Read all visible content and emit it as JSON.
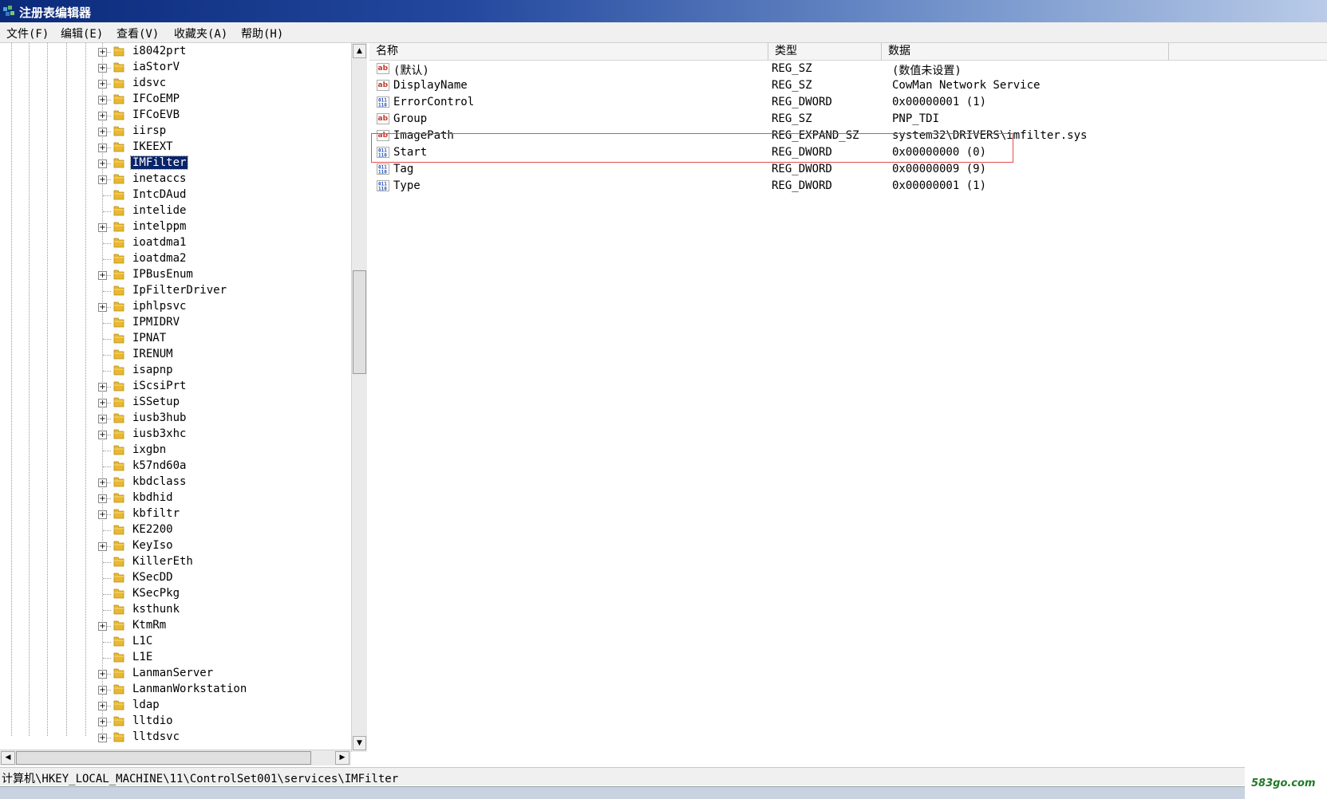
{
  "window": {
    "title": "注册表编辑器"
  },
  "menu": [
    "文件(F)",
    "编辑(E)",
    "查看(V)",
    "收藏夹(A)",
    "帮助(H)"
  ],
  "tree": {
    "selected": "IMFilter",
    "items": [
      {
        "label": "i8042prt",
        "expandable": true
      },
      {
        "label": "iaStorV",
        "expandable": true
      },
      {
        "label": "idsvc",
        "expandable": true
      },
      {
        "label": "IFCoEMP",
        "expandable": true
      },
      {
        "label": "IFCoEVB",
        "expandable": true
      },
      {
        "label": "iirsp",
        "expandable": true
      },
      {
        "label": "IKEEXT",
        "expandable": true
      },
      {
        "label": "IMFilter",
        "expandable": true
      },
      {
        "label": "inetaccs",
        "expandable": true
      },
      {
        "label": "IntcDAud",
        "expandable": false
      },
      {
        "label": "intelide",
        "expandable": false
      },
      {
        "label": "intelppm",
        "expandable": true
      },
      {
        "label": "ioatdma1",
        "expandable": false
      },
      {
        "label": "ioatdma2",
        "expandable": false
      },
      {
        "label": "IPBusEnum",
        "expandable": true
      },
      {
        "label": "IpFilterDriver",
        "expandable": false
      },
      {
        "label": "iphlpsvc",
        "expandable": true
      },
      {
        "label": "IPMIDRV",
        "expandable": false
      },
      {
        "label": "IPNAT",
        "expandable": false
      },
      {
        "label": "IRENUM",
        "expandable": false
      },
      {
        "label": "isapnp",
        "expandable": false
      },
      {
        "label": "iScsiPrt",
        "expandable": true
      },
      {
        "label": "iSSetup",
        "expandable": true
      },
      {
        "label": "iusb3hub",
        "expandable": true
      },
      {
        "label": "iusb3xhc",
        "expandable": true
      },
      {
        "label": "ixgbn",
        "expandable": false
      },
      {
        "label": "k57nd60a",
        "expandable": false
      },
      {
        "label": "kbdclass",
        "expandable": true
      },
      {
        "label": "kbdhid",
        "expandable": true
      },
      {
        "label": "kbfiltr",
        "expandable": true
      },
      {
        "label": "KE2200",
        "expandable": false
      },
      {
        "label": "KeyIso",
        "expandable": true
      },
      {
        "label": "KillerEth",
        "expandable": false
      },
      {
        "label": "KSecDD",
        "expandable": false
      },
      {
        "label": "KSecPkg",
        "expandable": false
      },
      {
        "label": "ksthunk",
        "expandable": false
      },
      {
        "label": "KtmRm",
        "expandable": true
      },
      {
        "label": "L1C",
        "expandable": false
      },
      {
        "label": "L1E",
        "expandable": false
      },
      {
        "label": "LanmanServer",
        "expandable": true
      },
      {
        "label": "LanmanWorkstation",
        "expandable": true
      },
      {
        "label": "ldap",
        "expandable": true
      },
      {
        "label": "lltdio",
        "expandable": true
      },
      {
        "label": "lltdsvc",
        "expandable": true
      }
    ]
  },
  "list": {
    "columns": [
      "名称",
      "类型",
      "数据"
    ],
    "rows": [
      {
        "icon": "string-value-icon",
        "name": "(默认)",
        "type": "REG_SZ",
        "data": "(数值未设置)"
      },
      {
        "icon": "string-value-icon",
        "name": "DisplayName",
        "type": "REG_SZ",
        "data": "CowMan Network Service"
      },
      {
        "icon": "binary-value-icon",
        "name": "ErrorControl",
        "type": "REG_DWORD",
        "data": "0x00000001 (1)"
      },
      {
        "icon": "string-value-icon",
        "name": "Group",
        "type": "REG_SZ",
        "data": "PNP_TDI"
      },
      {
        "icon": "string-value-icon",
        "name": "ImagePath",
        "type": "REG_EXPAND_SZ",
        "data": "system32\\DRIVERS\\imfilter.sys"
      },
      {
        "icon": "binary-value-icon",
        "name": "Start",
        "type": "REG_DWORD",
        "data": "0x00000000 (0)"
      },
      {
        "icon": "binary-value-icon",
        "name": "Tag",
        "type": "REG_DWORD",
        "data": "0x00000009 (9)"
      },
      {
        "icon": "binary-value-icon",
        "name": "Type",
        "type": "REG_DWORD",
        "data": "0x00000001 (1)"
      }
    ]
  },
  "status": {
    "path": "计算机\\HKEY_LOCAL_MACHINE\\11\\ControlSet001\\services\\IMFilter"
  },
  "watermark": "583go.com",
  "colors": {
    "title_start": "#0b2a7a",
    "selection": "#0a246a",
    "highlight_box": "#e05050",
    "string_icon": "#c0392b",
    "binary_icon": "#1f4fb5",
    "folder": "#e8b830"
  }
}
